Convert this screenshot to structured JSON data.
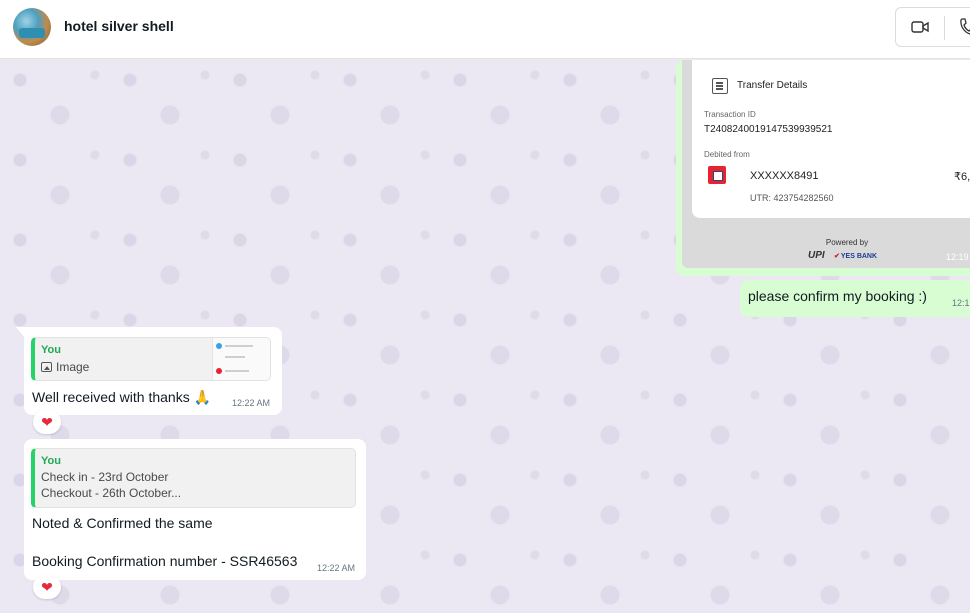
{
  "header": {
    "title": "hotel silver shell"
  },
  "receipt": {
    "section_title": "Transfer Details",
    "transaction_label": "Transaction ID",
    "transaction_id": "T2408240019147539939521",
    "debited_label": "Debited from",
    "account": "XXXXXX8491",
    "amount": "₹6,",
    "utr": "UTR: 423754282560",
    "powered_by": "Powered by",
    "upi_logo": "UPI",
    "bank_logo": "YES BANK",
    "time": "12:19"
  },
  "messages": {
    "outgoing_text": "please confirm my booking :)",
    "outgoing_time": "12:1",
    "incoming_1": {
      "quote_author": "You",
      "quote_label": "Image",
      "text": "Well received with thanks 🙏",
      "time": "12:22 AM",
      "reaction": "❤"
    },
    "incoming_2": {
      "quote_author": "You",
      "quote_line_1": "Check in  - 23rd October",
      "quote_line_2": "Checkout - 26th October...",
      "text_1": "Noted & Confirmed the same",
      "text_2": "Booking Confirmation number - SSR46563",
      "time": "12:22 AM",
      "reaction": "❤"
    }
  },
  "colors": {
    "accent_green": "#25d366",
    "outgoing_bubble": "#d8fdd2",
    "chat_background": "#ebe7f3",
    "reaction_red": "#e32b3d"
  },
  "icons": [
    "video-call-icon",
    "voice-call-icon",
    "transfer-details-icon",
    "bank-logo-icon",
    "image-icon",
    "heart-reaction-icon"
  ]
}
